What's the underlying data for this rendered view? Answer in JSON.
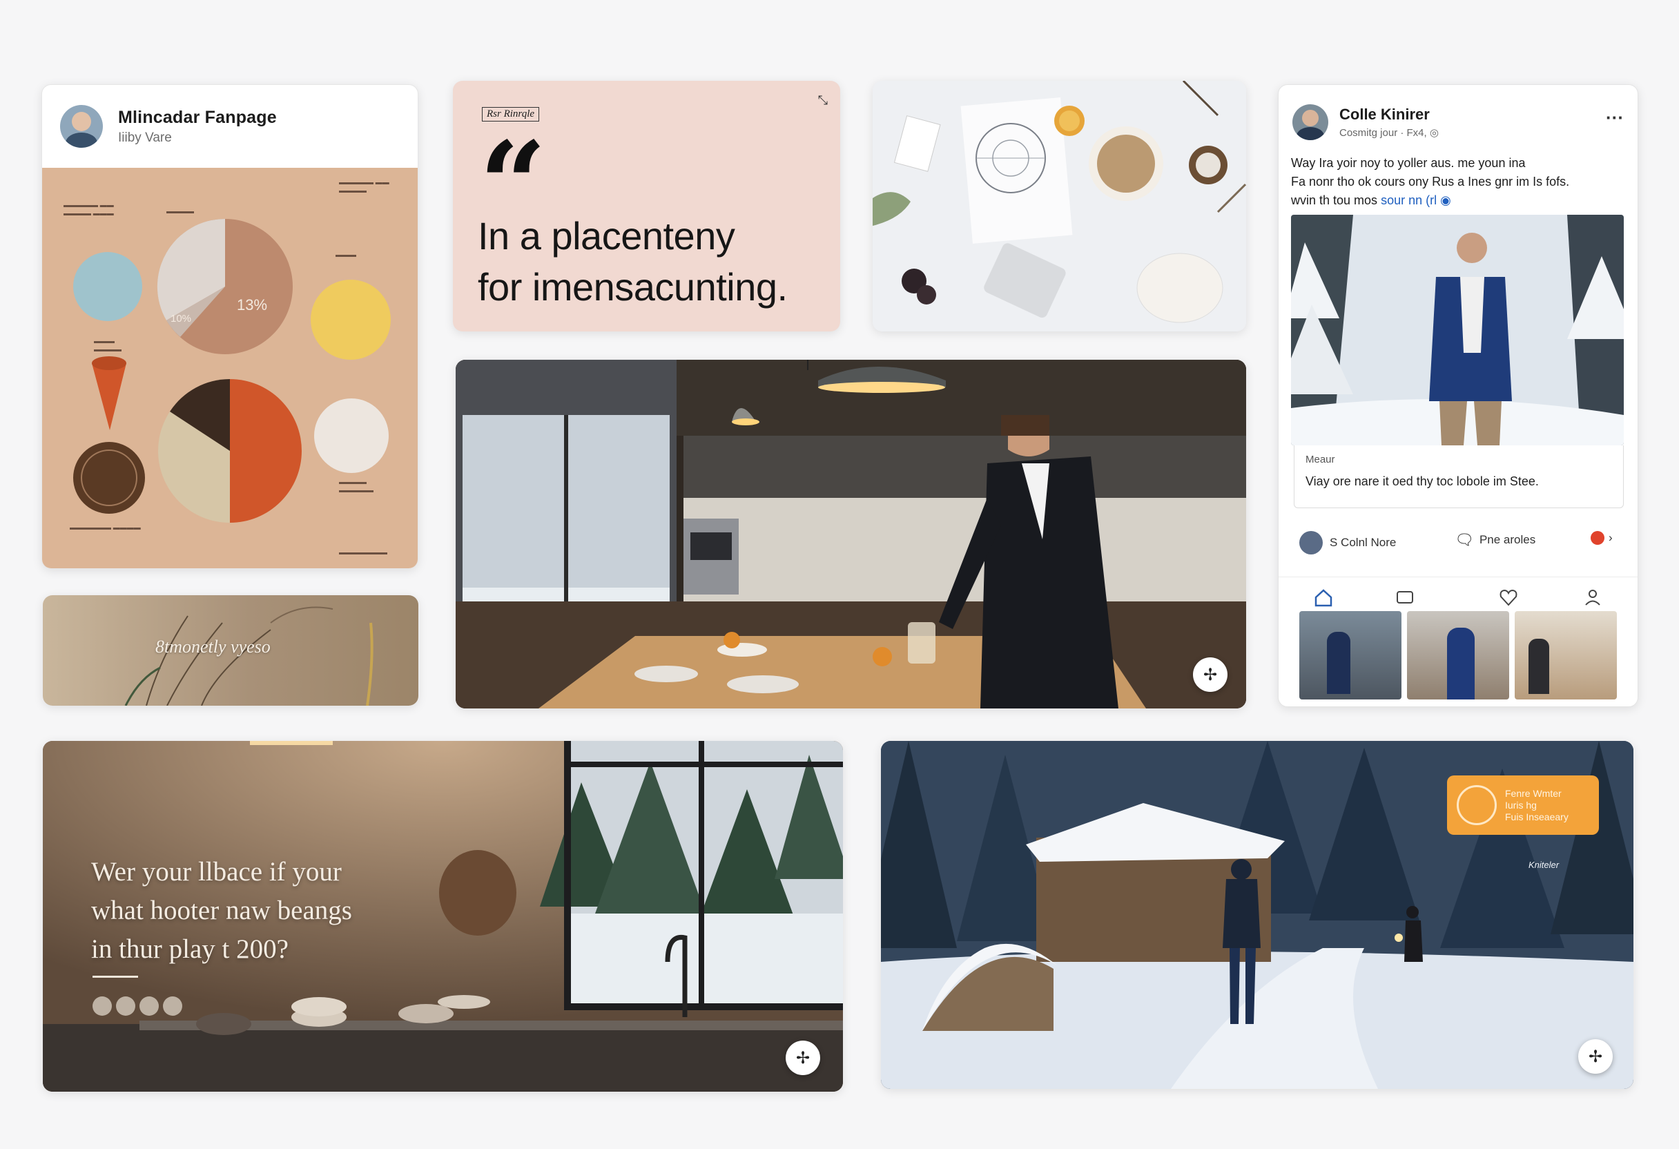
{
  "infographic_card": {
    "title": "Mlincadar Fanpage",
    "subtitle": "Iiiby Vare",
    "pct_label_1": "13%",
    "pct_label_2": "10%",
    "colors": {
      "card_bg": "#dcb596",
      "blue": "#9fc3cc",
      "yellow": "#efcb5e",
      "orange": "#d0562a",
      "brown": "#5a3a24"
    }
  },
  "quote_card": {
    "tag": "Rsr Rinrqle",
    "mark": "“",
    "line1": "In a placenteny",
    "line2": "for imensacunting.",
    "bg": "#f1d9d1"
  },
  "banner_card": {
    "label": "8tmonetly vyeso"
  },
  "post_card": {
    "author": "Colle Kinirer",
    "meta": "Cosmitg jour · Fx4, ◎",
    "more": "···",
    "body_line1": "Way Ira yoir noy to yoller aus. me youn ina",
    "body_line2": "Fa nonr tho ok cours ony Rus a Ines gnr im Is fofs.",
    "body_line3": "wvin th tou mos",
    "body_link": "sour nn (rl",
    "caption_small": "Meaur",
    "caption": "Viay ore nare it oed thy toc lobole im Stee.",
    "action1": "S Colnl Nore",
    "action2": "Pne aroles"
  },
  "window_card": {
    "line1": "Wer your llbace if your",
    "line2": "what hooter naw beangs",
    "line3": "in thur play t 200?"
  },
  "cabin_card": {
    "badge_line1": "Fenre Wmter",
    "badge_line2": "Iuris hg",
    "badge_line3": "Fuis Inseaeary",
    "caption": "Kniteler",
    "accent": "#f3a33a"
  },
  "fab_symbol": "✢"
}
